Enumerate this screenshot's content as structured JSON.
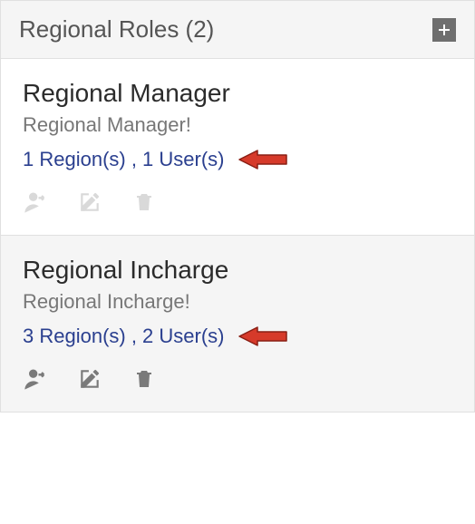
{
  "header": {
    "title": "Regional Roles (2)"
  },
  "roles": [
    {
      "title": "Regional Manager",
      "subtitle": "Regional Manager!",
      "stats": "1 Region(s) , 1 User(s)"
    },
    {
      "title": "Regional Incharge",
      "subtitle": "Regional Incharge!",
      "stats": "3 Region(s) , 2 User(s)"
    }
  ]
}
